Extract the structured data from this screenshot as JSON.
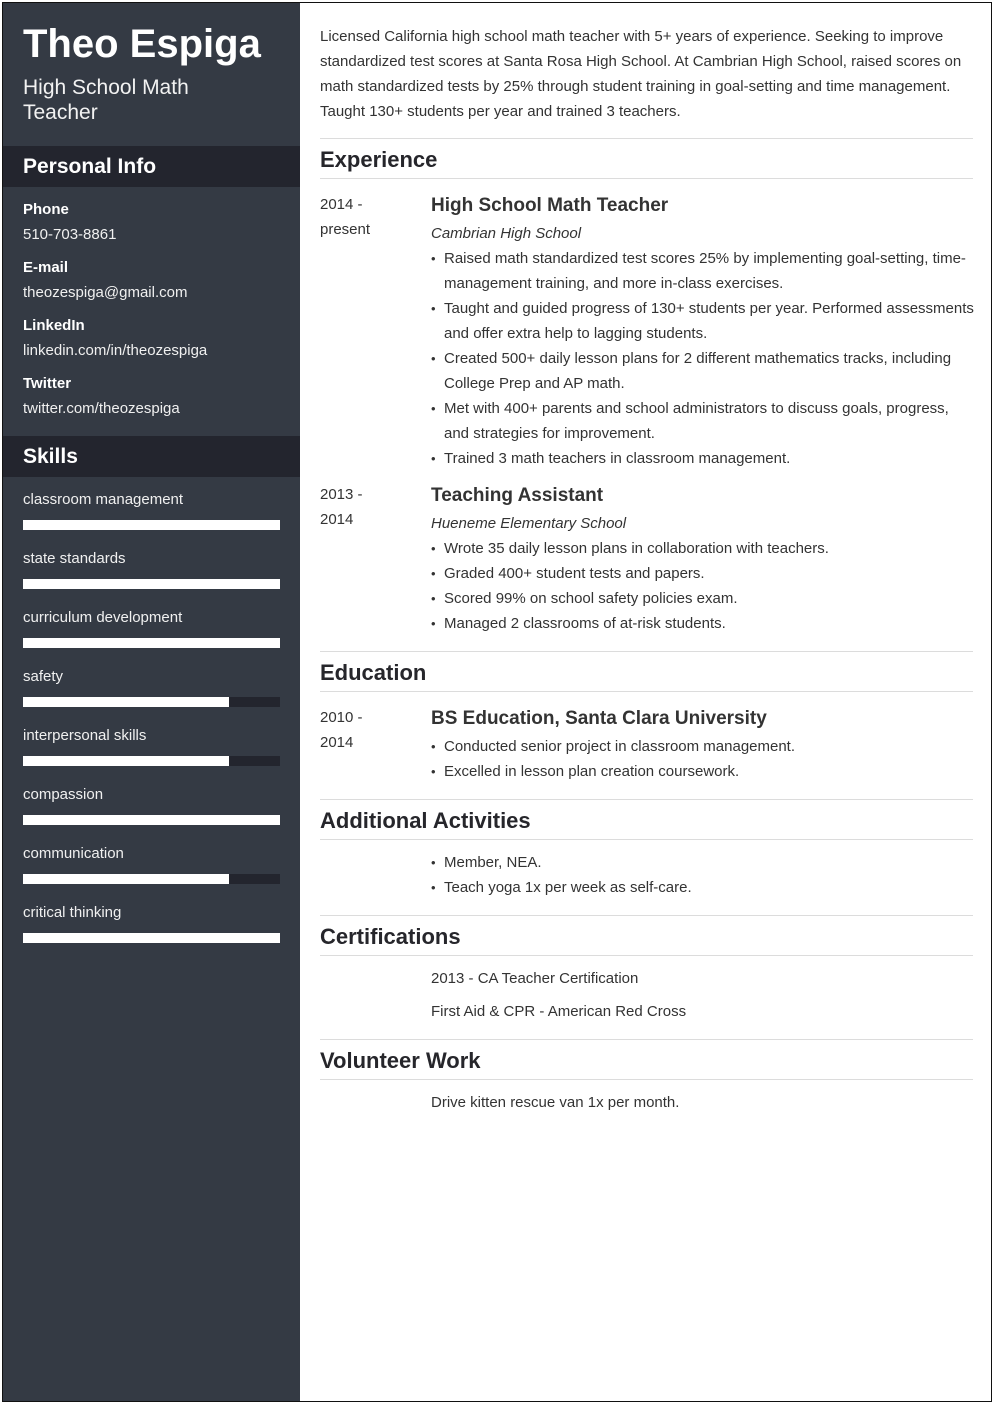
{
  "header": {
    "name": "Theo Espiga",
    "title": "High School Math Teacher"
  },
  "personal_info": {
    "heading": "Personal Info",
    "items": [
      {
        "label": "Phone",
        "value": "510-703-8861"
      },
      {
        "label": "E-mail",
        "value": "theozespiga@gmail.com"
      },
      {
        "label": "LinkedIn",
        "value": "linkedin.com/in/theozespiga"
      },
      {
        "label": "Twitter",
        "value": "twitter.com/theozespiga"
      }
    ]
  },
  "skills": {
    "heading": "Skills",
    "items": [
      {
        "name": "classroom management",
        "level": 1.0
      },
      {
        "name": "state standards",
        "level": 1.0
      },
      {
        "name": "curriculum development",
        "level": 1.0
      },
      {
        "name": "safety",
        "level": 0.8
      },
      {
        "name": "interpersonal skills",
        "level": 0.8
      },
      {
        "name": "compassion",
        "level": 1.0
      },
      {
        "name": "communication",
        "level": 0.8
      },
      {
        "name": "critical thinking",
        "level": 1.0
      }
    ]
  },
  "summary": "Licensed California high school math teacher with 5+ years of experience. Seeking to improve standardized test scores at Santa Rosa High School. At Cambrian High School, raised scores on math standardized tests by 25% through student training in goal-setting and time management. Taught 130+ students per year and trained 3 teachers.",
  "experience": {
    "heading": "Experience",
    "jobs": [
      {
        "date_start": "2014 -",
        "date_end": "present",
        "title": "High School Math Teacher",
        "company": "Cambrian High School",
        "bullets": [
          "Raised math standardized test scores 25% by implementing goal-setting, time-management training, and more in-class exercises.",
          "Taught and guided progress of 130+ students per year. Performed assessments and offer extra help to lagging students.",
          "Created 500+ daily lesson plans for 2 different mathematics tracks, including College Prep and AP math.",
          "Met with 400+ parents and school administrators to discuss goals, progress, and strategies for improvement.",
          "Trained 3 math teachers in classroom management."
        ]
      },
      {
        "date_start": "2013 -",
        "date_end": "2014",
        "title": "Teaching Assistant",
        "company": "Hueneme Elementary School",
        "bullets": [
          "Wrote 35 daily lesson plans in collaboration with teachers.",
          "Graded 400+ student tests and papers.",
          "Scored 99% on school safety policies exam.",
          "Managed 2 classrooms of at-risk students."
        ]
      }
    ]
  },
  "education": {
    "heading": "Education",
    "date_start": "2010 -",
    "date_end": "2014",
    "degree": "BS Education, Santa Clara University",
    "bullets": [
      "Conducted senior project in classroom management.",
      "Excelled in lesson plan creation coursework."
    ]
  },
  "activities": {
    "heading": "Additional Activities",
    "bullets": [
      "Member, NEA.",
      "Teach yoga 1x per week as self-care."
    ]
  },
  "certifications": {
    "heading": "Certifications",
    "items": [
      "2013 - CA Teacher Certification",
      "First Aid & CPR - American Red Cross"
    ]
  },
  "volunteer": {
    "heading": "Volunteer Work",
    "items": [
      "Drive kitten rescue van 1x per month."
    ]
  },
  "colors": {
    "sidebar_bg": "#343a44",
    "sidebar_heading_bg": "#23252e",
    "skill_fill": "#ffffff",
    "skill_track": "#23252e"
  }
}
